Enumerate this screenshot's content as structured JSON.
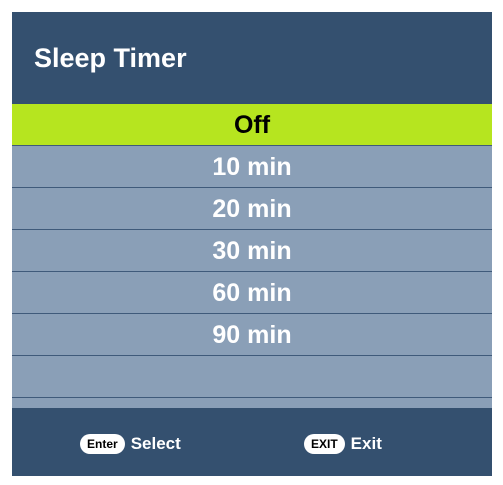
{
  "dialog": {
    "title": "Sleep Timer"
  },
  "options": [
    {
      "label": "Off",
      "selected": true
    },
    {
      "label": "10 min",
      "selected": false
    },
    {
      "label": "20 min",
      "selected": false
    },
    {
      "label": "30 min",
      "selected": false
    },
    {
      "label": "60 min",
      "selected": false
    },
    {
      "label": "90 min",
      "selected": false
    }
  ],
  "footer": {
    "select_key": "Enter",
    "select_label": "Select",
    "exit_key": "EXIT",
    "exit_label": "Exit"
  },
  "colors": {
    "panel_background": "#34506f",
    "list_background": "#8a9fb7",
    "selected_background": "#b6e51f",
    "separator": "#3f5a7a"
  }
}
